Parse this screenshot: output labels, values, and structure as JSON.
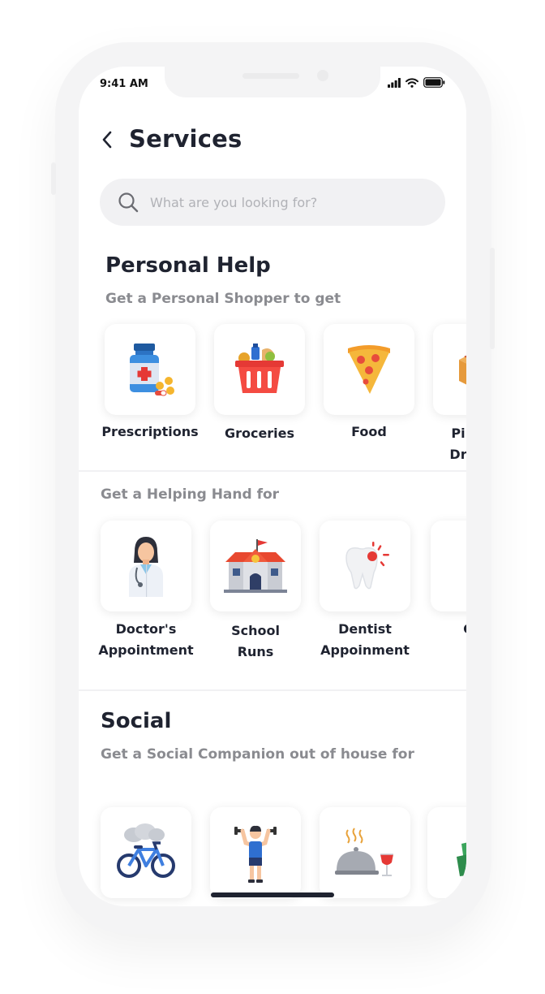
{
  "status_bar": {
    "time": "9:41 AM"
  },
  "header": {
    "title": "Services"
  },
  "search": {
    "placeholder": "What are you looking for?"
  },
  "personal_help": {
    "title": "Personal Help",
    "subtitle": "Get a Personal Shopper to get",
    "items": [
      {
        "label": "Prescriptions",
        "icon": "medicine-bottle-icon"
      },
      {
        "label": "Groceries",
        "icon": "grocery-basket-icon"
      },
      {
        "label": "Food",
        "icon": "pizza-slice-icon"
      },
      {
        "label": "Pi\nDr",
        "icon": "parcel-box-icon"
      }
    ]
  },
  "helping_hand": {
    "subtitle": "Get a Helping Hand for",
    "items": [
      {
        "label": "Doctor's\nAppointment",
        "icon": "doctor-icon"
      },
      {
        "label": "School\nRuns",
        "icon": "school-building-icon"
      },
      {
        "label": "Dentist\nAppoinment",
        "icon": "tooth-icon"
      },
      {
        "label": "Gar",
        "icon": "garden-tool-icon"
      }
    ]
  },
  "social": {
    "title": "Social",
    "subtitle": "Get a Social Companion out of house for",
    "items": [
      {
        "icon": "bicycle-icon"
      },
      {
        "icon": "fitness-man-icon"
      },
      {
        "icon": "food-cloche-icon"
      },
      {
        "icon": "shopping-bags-icon"
      }
    ]
  }
}
